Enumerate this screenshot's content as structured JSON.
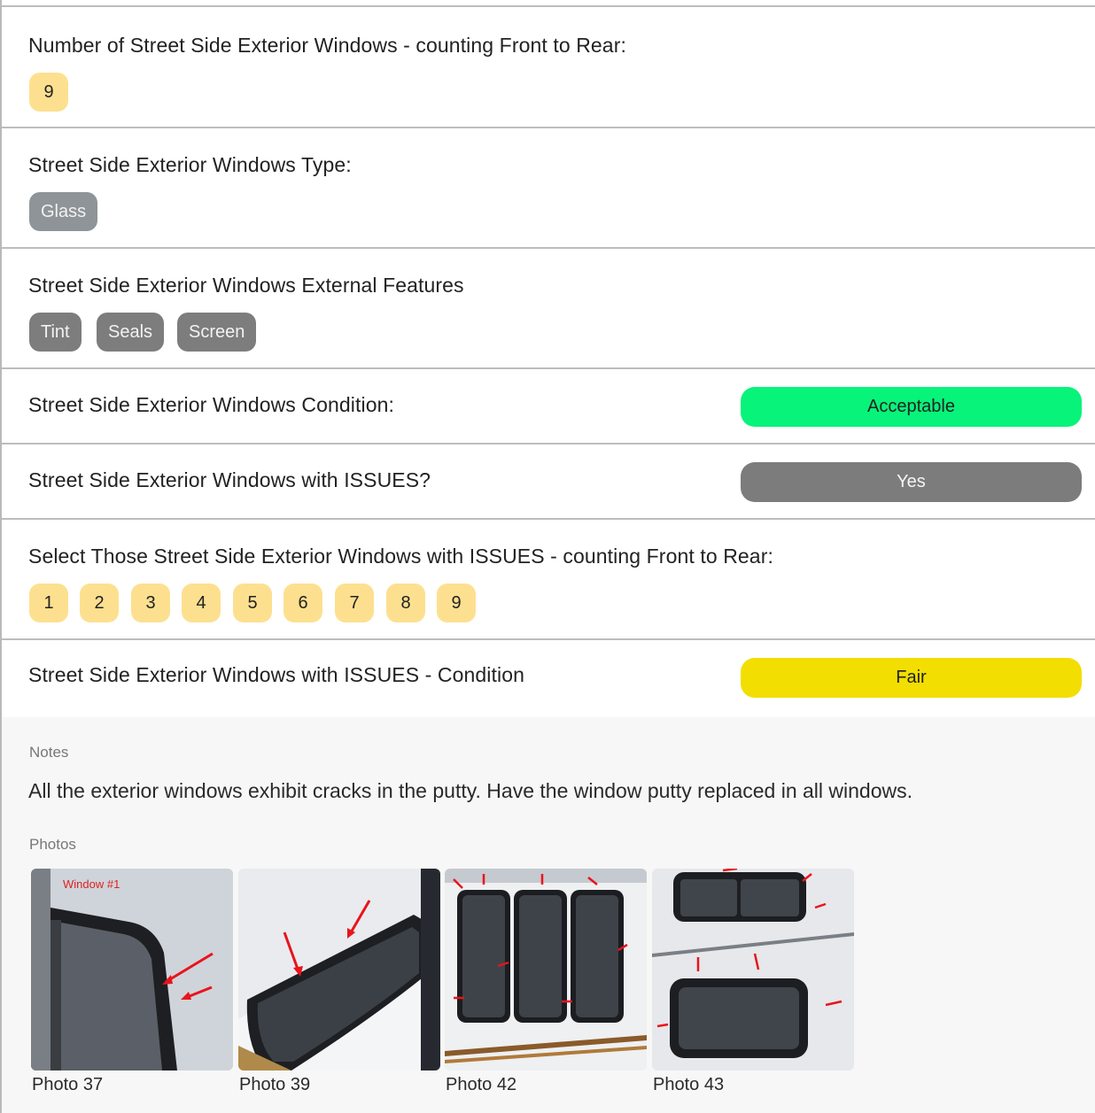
{
  "sections": {
    "window_count": {
      "label": "Number of Street Side Exterior Windows - counting Front to Rear:",
      "value": "9"
    },
    "window_type": {
      "label": "Street Side Exterior Windows Type:",
      "value": "Glass"
    },
    "features": {
      "label": "Street Side Exterior Windows External Features",
      "items": [
        "Tint",
        "Seals",
        "Screen"
      ]
    },
    "condition": {
      "label": "Street Side Exterior Windows Condition:",
      "value": "Acceptable",
      "color": "#08f37a"
    },
    "issues": {
      "label": "Street Side Exterior Windows with ISSUES?",
      "value": "Yes",
      "color": "#7c7c7c"
    },
    "issue_windows": {
      "label": "Select Those Street Side Exterior Windows with ISSUES - counting Front to Rear:",
      "items": [
        "1",
        "2",
        "3",
        "4",
        "5",
        "6",
        "7",
        "8",
        "9"
      ]
    },
    "issue_condition": {
      "label": "Street Side Exterior Windows with ISSUES - Condition",
      "value": "Fair",
      "color": "#f2de00"
    }
  },
  "notes": {
    "label": "Notes",
    "text": "All the exterior windows exhibit cracks in the putty. Have the window putty replaced in all windows."
  },
  "photos": {
    "label": "Photos",
    "items": [
      {
        "caption": "Photo 37",
        "overlay_text": "Window #1"
      },
      {
        "caption": "Photo 39"
      },
      {
        "caption": "Photo 42"
      },
      {
        "caption": "Photo 43"
      }
    ]
  }
}
